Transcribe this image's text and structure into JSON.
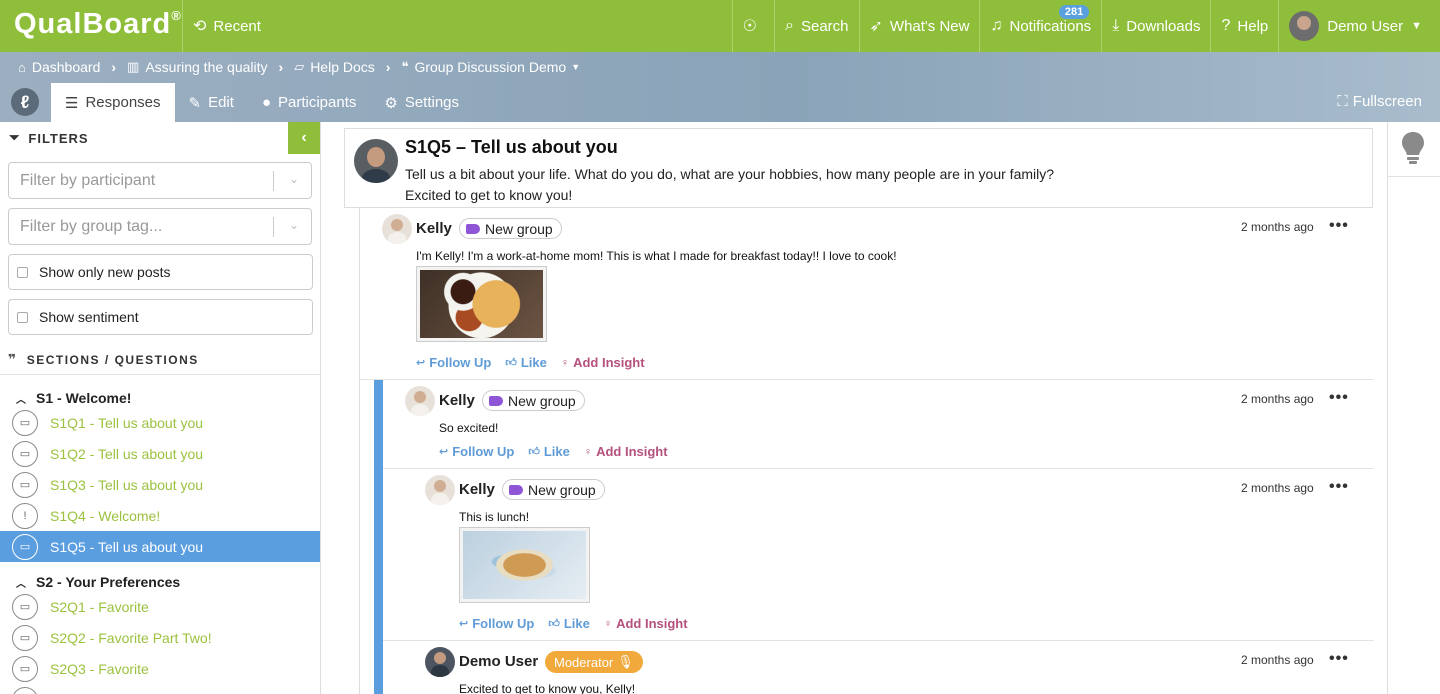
{
  "topbar": {
    "logo": "QualBoard",
    "logo_mark": "®",
    "recent": "Recent",
    "search": "Search",
    "whats_new": "What's New",
    "notifications": "Notifications",
    "notifications_count": "281",
    "downloads": "Downloads",
    "help": "Help",
    "user": "Demo User",
    "brand_color": "#8fbf3a"
  },
  "breadcrumb": [
    {
      "label": "Dashboard",
      "icon": "home-icon"
    },
    {
      "label": "Assuring the quality",
      "icon": "building-icon"
    },
    {
      "label": "Help Docs",
      "icon": "folder-icon"
    },
    {
      "label": "Group Discussion Demo",
      "icon": "discussion-icon"
    }
  ],
  "tabs": {
    "responses": "Responses",
    "edit": "Edit",
    "participants": "Participants",
    "settings": "Settings",
    "fullscreen": "Fullscreen"
  },
  "sidebar": {
    "filters_title": "FILTERS",
    "participant_placeholder": "Filter by participant",
    "group_tag_placeholder": "Filter by group tag...",
    "show_new": "Show only new posts",
    "show_sentiment": "Show sentiment",
    "sections_title": "SECTIONS / QUESTIONS",
    "sections": [
      {
        "title": "S1 - Welcome!",
        "questions": [
          "S1Q1 - Tell us about you",
          "S1Q2 - Tell us about you",
          "S1Q3 - Tell us about you",
          "S1Q4 - Welcome!",
          "S1Q5 - Tell us about you"
        ]
      },
      {
        "title": "S2 - Your Preferences",
        "questions": [
          "S2Q1 - Favorite",
          "S2Q2 - Favorite Part Two!",
          "S2Q3 - Favorite"
        ]
      }
    ],
    "active_color": "#5b9ee0"
  },
  "question": {
    "title": "S1Q5 – Tell us about you",
    "line1": "Tell us a bit about your life. What do you do, what are your hobbies, how many people are in your family?",
    "line2": "Excited to get to know you!"
  },
  "posts": [
    {
      "name": "Kelly",
      "tag": "New group",
      "time": "2 months ago",
      "body": "I'm Kelly! I'm a work-at-home mom! This is what I made for breakfast today!! I love to cook!"
    },
    {
      "name": "Kelly",
      "tag": "New group",
      "time": "2 months ago",
      "body": "So excited!"
    },
    {
      "name": "Kelly",
      "tag": "New group",
      "time": "2 months ago",
      "body": "This is lunch!"
    },
    {
      "name": "Demo User",
      "tag": "Moderator",
      "time": "2 months ago",
      "body": "Excited to get to know you, Kelly!"
    }
  ],
  "actions": {
    "follow_up": "Follow Up",
    "like": "Like",
    "insight": "Add Insight",
    "link_color": "#5f9bd6",
    "insight_color": "#b5517e"
  },
  "icons": {
    "more": "•••",
    "chevron_left": "‹",
    "chevron_down": "⌄"
  }
}
